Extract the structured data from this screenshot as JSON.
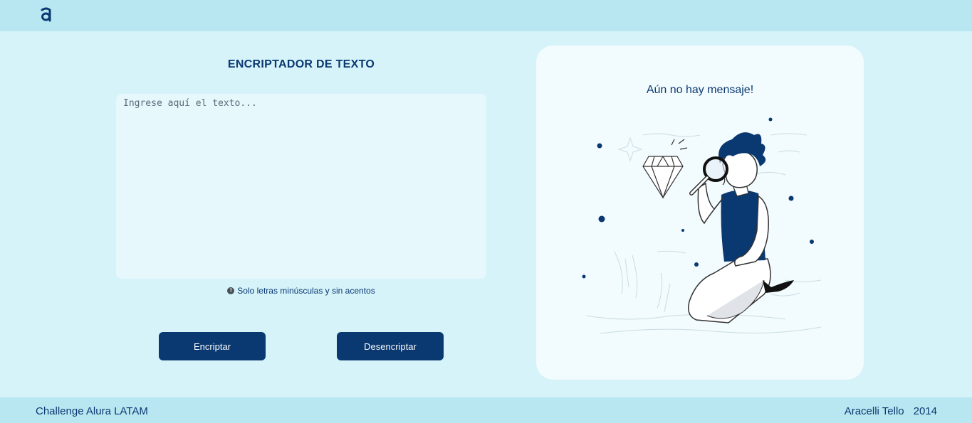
{
  "header": {
    "logo_icon": "alura-logo-icon"
  },
  "main": {
    "title": "ENCRIPTADOR DE TEXTO",
    "input": {
      "placeholder": "Ingrese aquí el texto...",
      "value": ""
    },
    "hint": {
      "icon": "info-icon",
      "text": "Solo letras minúsculas y sin acentos"
    },
    "buttons": {
      "encrypt": "Encriptar",
      "decrypt": "Desencriptar"
    }
  },
  "output_panel": {
    "message": "Aún no hay mensaje!",
    "illustration": "person-with-magnifying-glass-illustration"
  },
  "footer": {
    "left": "Challenge Alura LATAM",
    "author": "Aracelli Tello",
    "year": "2014"
  },
  "colors": {
    "primary": "#0a3871",
    "background": "#d6f3fa",
    "header": "#b9e7f1",
    "panel": "#f2fbfd",
    "textarea": "#e6f8fc"
  }
}
